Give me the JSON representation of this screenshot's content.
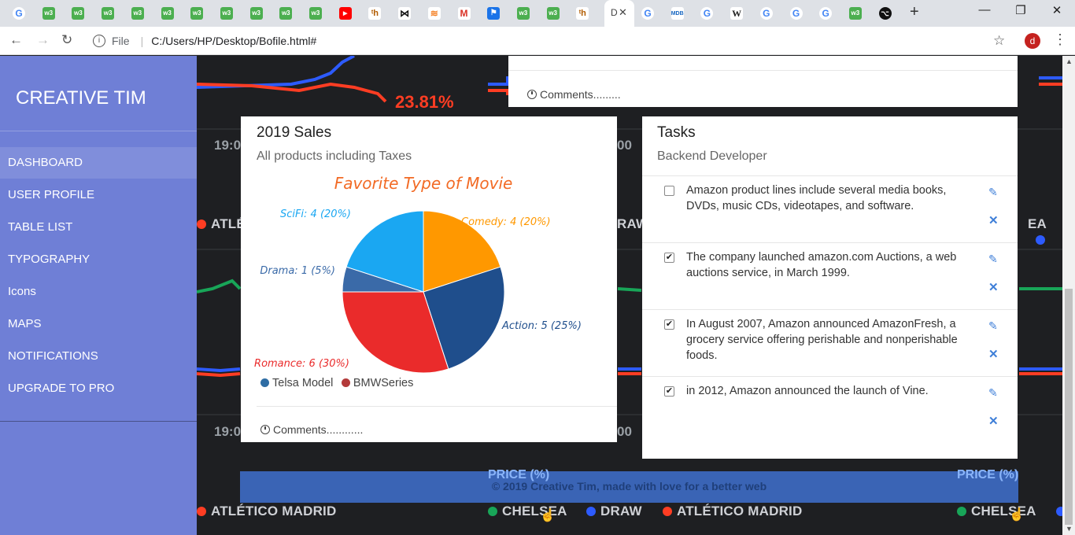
{
  "browser": {
    "tab_icons": [
      "google-icon",
      "w3schools-icon",
      "w3schools-icon",
      "w3schools-icon",
      "w3schools-icon",
      "w3schools-icon",
      "w3schools-icon",
      "w3schools-icon",
      "w3schools-icon",
      "w3schools-icon",
      "w3schools-icon",
      "youtube-icon",
      "tutorial-icon",
      "bowtie-icon",
      "stackoverflow-icon",
      "gmail-icon",
      "flag-icon",
      "w3schools-icon",
      "w3schools-icon",
      "tutorial-icon"
    ],
    "active_tab_label": "D",
    "after_tabs": [
      "google-icon",
      "mdb-icon",
      "google-icon",
      "wikipedia-icon",
      "google-icon",
      "google-icon",
      "google-icon",
      "w3schools-icon",
      "github-icon"
    ],
    "address_scheme": "File",
    "address_url": "C:/Users/HP/Desktop/Bofile.html#",
    "profile_initial": "d"
  },
  "sidebar": {
    "brand": "CREATIVE TIM",
    "items": [
      {
        "label": "DASHBOARD",
        "active": true
      },
      {
        "label": "USER PROFILE",
        "active": false
      },
      {
        "label": "TABLE LIST",
        "active": false
      },
      {
        "label": "TYPOGRAPHY",
        "active": false
      },
      {
        "label": "Icons",
        "active": false
      },
      {
        "label": "MAPS",
        "active": false
      },
      {
        "label": "NOTIFICATIONS",
        "active": false
      },
      {
        "label": "UPGRADE TO PRO",
        "active": false
      }
    ]
  },
  "background": {
    "pct_top": "23.81%",
    "time_left_1": "19:0",
    "time_right_1": "00",
    "time_left_2": "19:0",
    "time_right_2": "00",
    "row1_left": "ATLÉ",
    "row1_mid": "RAW",
    "row1_right": "EA",
    "price_label": "PRICE (%)",
    "bottom_row": [
      "ATLÉTICO MADRID",
      "CHELSEA",
      "DRAW",
      "ATLÉTICO MADRID",
      "CHELSEA"
    ],
    "colors": {
      "red": "#ff3d23",
      "blue": "#2d5bff",
      "green": "#18a558"
    }
  },
  "top_card": {
    "footer": "Comments........."
  },
  "sales_card": {
    "title": "2019 Sales",
    "subtitle": "All products including Taxes",
    "footer": "Comments............"
  },
  "chart_data": {
    "type": "pie",
    "title": "Favorite Type of Movie",
    "slices": [
      {
        "label": "Comedy",
        "value": 4,
        "percent": 20,
        "display": "Comedy: 4 (20%)",
        "color": "#ff9800"
      },
      {
        "label": "Action",
        "value": 5,
        "percent": 25,
        "display": "Action: 5 (25%)",
        "color": "#1f4e8c"
      },
      {
        "label": "Romance",
        "value": 6,
        "percent": 30,
        "display": "Romance: 6 (30%)",
        "color": "#ea2b2b"
      },
      {
        "label": "Drama",
        "value": 1,
        "percent": 5,
        "display": "Drama: 1 (5%)",
        "color": "#3a6aa8"
      },
      {
        "label": "SciFi",
        "value": 4,
        "percent": 20,
        "display": "SciFi: 4 (20%)",
        "color": "#1aa7f2"
      }
    ],
    "legend": [
      {
        "label": "Telsa Model",
        "color": "#2e6da4"
      },
      {
        "label": "BMWSeries",
        "color": "#b33a3a"
      }
    ]
  },
  "tasks_card": {
    "title": "Tasks",
    "subtitle": "Backend Developer",
    "tasks": [
      {
        "text": "Amazon product lines include several media books, DVDs, music CDs, videotapes, and software.",
        "checked": false
      },
      {
        "text": "The company launched amazon.com Auctions, a web auctions service, in March 1999.",
        "checked": true
      },
      {
        "text": "In August 2007, Amazon announced AmazonFresh, a grocery service offering perishable and nonperishable foods.",
        "checked": true
      },
      {
        "text": "in 2012, Amazon announced the launch of Vine.",
        "checked": true
      }
    ]
  },
  "footer": {
    "text": "© 2019 Creative Tim, made with love for a better web"
  }
}
